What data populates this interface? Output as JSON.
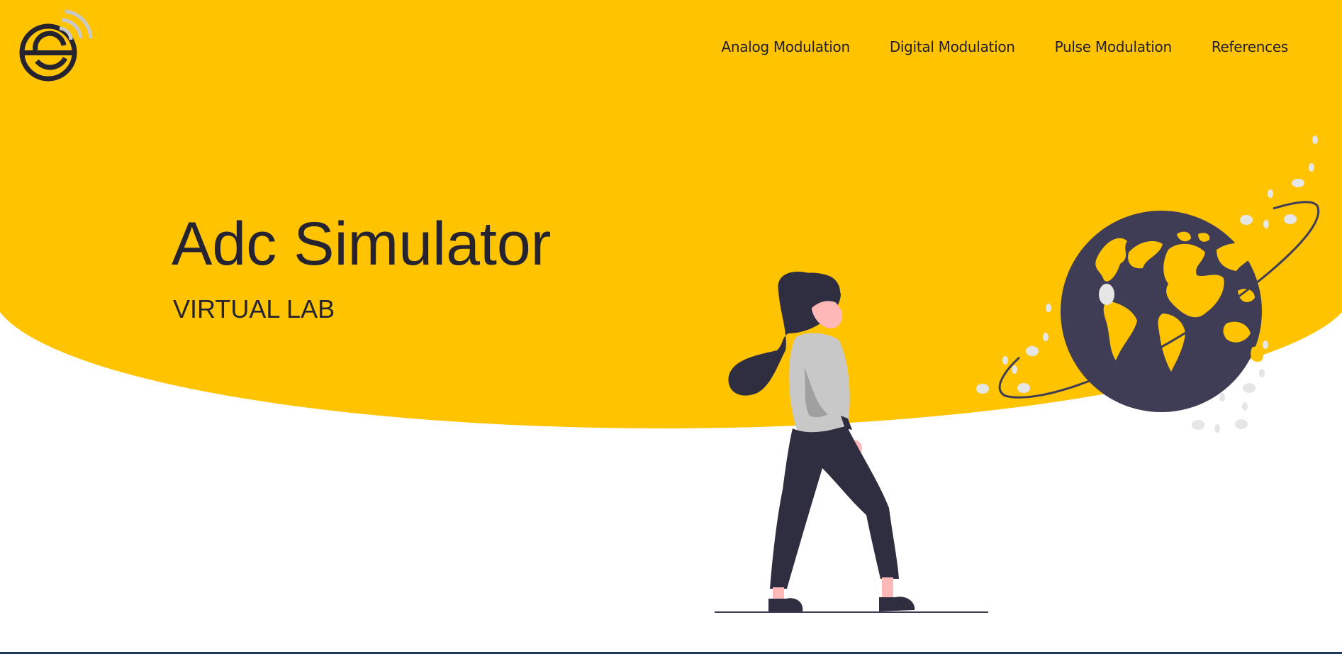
{
  "colors": {
    "accent": "#FFC300",
    "dark": "#2F2E41",
    "text": "#24232F",
    "skin": "#FFB8B8",
    "shirt": "#C8C8C8",
    "dots": "#E6E6E6",
    "footer_bar": "#1F3A5F"
  },
  "header": {
    "logo_icon": "wireless-e-logo",
    "nav": [
      {
        "label": "Analog Modulation"
      },
      {
        "label": "Digital Modulation"
      },
      {
        "label": "Pulse Modulation"
      },
      {
        "label": "References"
      }
    ]
  },
  "hero": {
    "title": "Adc Simulator",
    "subtitle": "VIRTUAL LAB",
    "illustration": {
      "person_icon": "walking-woman-illustration",
      "globe_icon": "globe-with-orbit-illustration"
    }
  }
}
